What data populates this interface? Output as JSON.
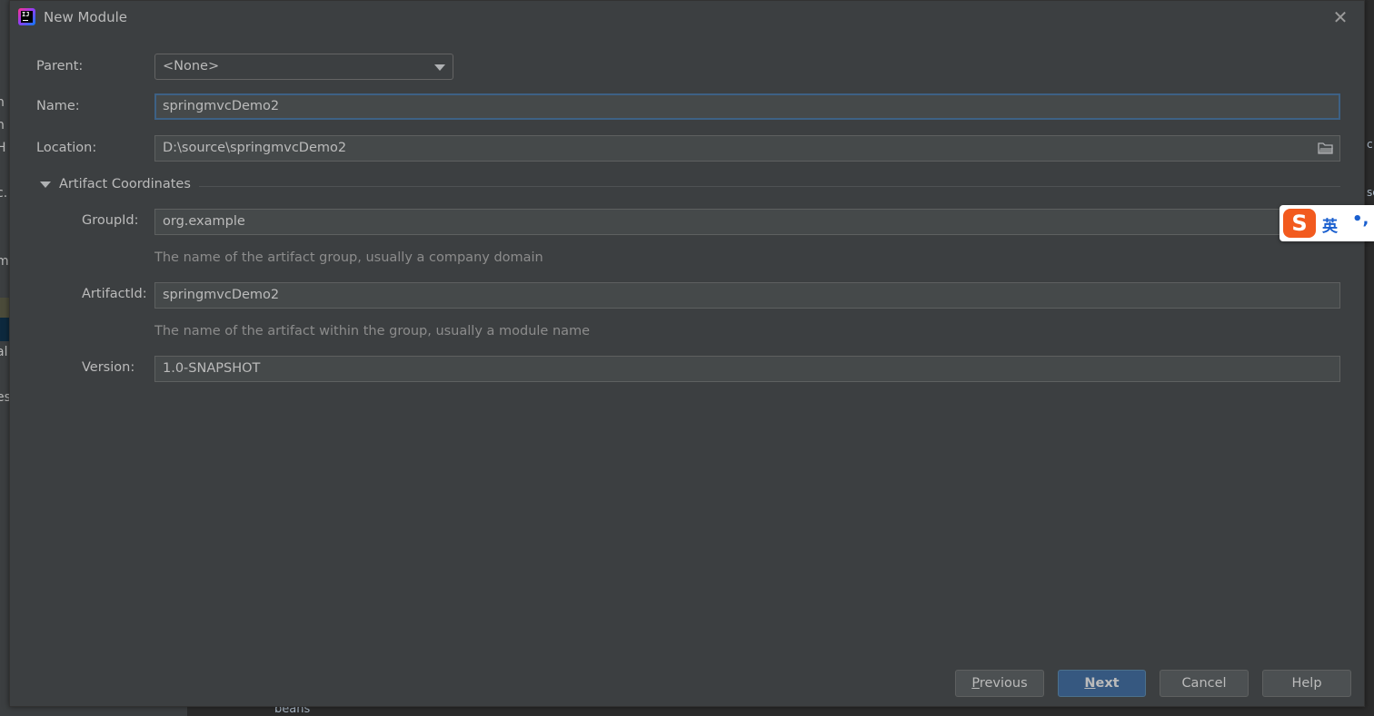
{
  "dialog": {
    "title": "New Module",
    "close_glyph": "✕",
    "app_icon_text": "IJ"
  },
  "form": {
    "parent_label": "Parent:",
    "parent_value": "<None>",
    "name_label": "Name:",
    "name_value": "springmvcDemo2",
    "location_label": "Location:",
    "location_value": "D:\\source\\springmvcDemo2",
    "artifact_section_title": "Artifact Coordinates",
    "group_id_label": "GroupId:",
    "group_id_value": "org.example",
    "group_id_hint": "The name of the artifact group, usually a company domain",
    "artifact_id_label": "ArtifactId:",
    "artifact_id_value": "springmvcDemo2",
    "artifact_id_hint": "The name of the artifact within the group, usually a module name",
    "version_label": "Version:",
    "version_value": "1.0-SNAPSHOT"
  },
  "buttons": {
    "previous_mnemonic": "P",
    "previous_rest": "revious",
    "next_mnemonic": "N",
    "next_rest": "ext",
    "cancel": "Cancel",
    "help": "Help"
  },
  "ime": {
    "logo": "S",
    "lang": "英",
    "punct": "•,"
  },
  "background": {
    "left_fragments": [
      "n",
      "n",
      "H",
      "c.",
      "m",
      "al",
      "es"
    ],
    "right_fragments": [
      "c",
      "sc"
    ],
    "bottom_text": "beans"
  },
  "icons": {
    "folder": "folder-icon",
    "dropdown": "chevron-down-icon",
    "close": "close-icon",
    "section_toggle": "triangle-down-icon"
  },
  "colors": {
    "dialog_bg": "#3c3f41",
    "field_bg": "#45494a",
    "focus_border": "#3d6185",
    "primary_button": "#365880",
    "text": "#bbbbbb",
    "hint_text": "#8c8c8c"
  }
}
